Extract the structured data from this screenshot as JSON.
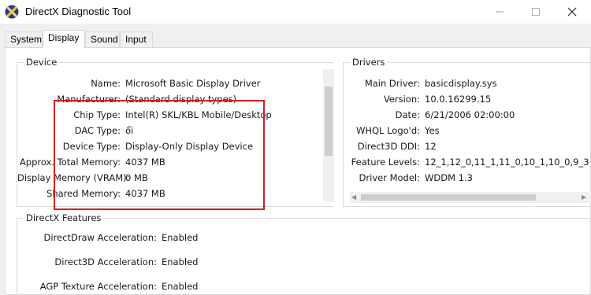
{
  "window": {
    "title": "DirectX Diagnostic Tool",
    "icon": "directx-x-icon"
  },
  "tabs": [
    {
      "label": "System"
    },
    {
      "label": "Display"
    },
    {
      "label": "Sound"
    },
    {
      "label": "Input"
    }
  ],
  "device": {
    "title": "Device",
    "rows": [
      {
        "label": "Name:",
        "value": "Microsoft Basic Display Driver"
      },
      {
        "label": "Manufacturer:",
        "value": "(Standard display types)"
      },
      {
        "label": "Chip Type:",
        "value": "Intel(R) SKL/KBL Mobile/Desktop"
      },
      {
        "label": "DAC Type:",
        "value": "ổi"
      },
      {
        "label": "Device Type:",
        "value": "Display-Only Display Device"
      },
      {
        "label": "Approx. Total Memory:",
        "value": "4037 MB"
      },
      {
        "label": "Display Memory (VRAM):",
        "value": "0 MB"
      },
      {
        "label": "Shared Memory:",
        "value": "4037 MB"
      }
    ]
  },
  "drivers": {
    "title": "Drivers",
    "rows": [
      {
        "label": "Main Driver:",
        "value": "basicdisplay.sys"
      },
      {
        "label": "Version:",
        "value": "10.0.16299.15"
      },
      {
        "label": "Date:",
        "value": "6/21/2006 02:00:00"
      },
      {
        "label": "WHQL Logo'd:",
        "value": "Yes"
      },
      {
        "label": "Direct3D DDI:",
        "value": "12"
      },
      {
        "label": "Feature Levels:",
        "value": "12_1,12_0,11_1,11_0,10_1,10_0,9_3"
      },
      {
        "label": "Driver Model:",
        "value": "WDDM 1.3"
      }
    ]
  },
  "features": {
    "title": "DirectX Features",
    "rows": [
      {
        "label": "DirectDraw Acceleration:",
        "value": "Enabled"
      },
      {
        "label": "Direct3D Acceleration:",
        "value": "Enabled"
      },
      {
        "label": "AGP Texture Acceleration:",
        "value": "Enabled"
      }
    ]
  },
  "colors": {
    "highlight": "#d32020",
    "panel_bg": "#ffffff",
    "window_bg": "#f0f0f0"
  }
}
